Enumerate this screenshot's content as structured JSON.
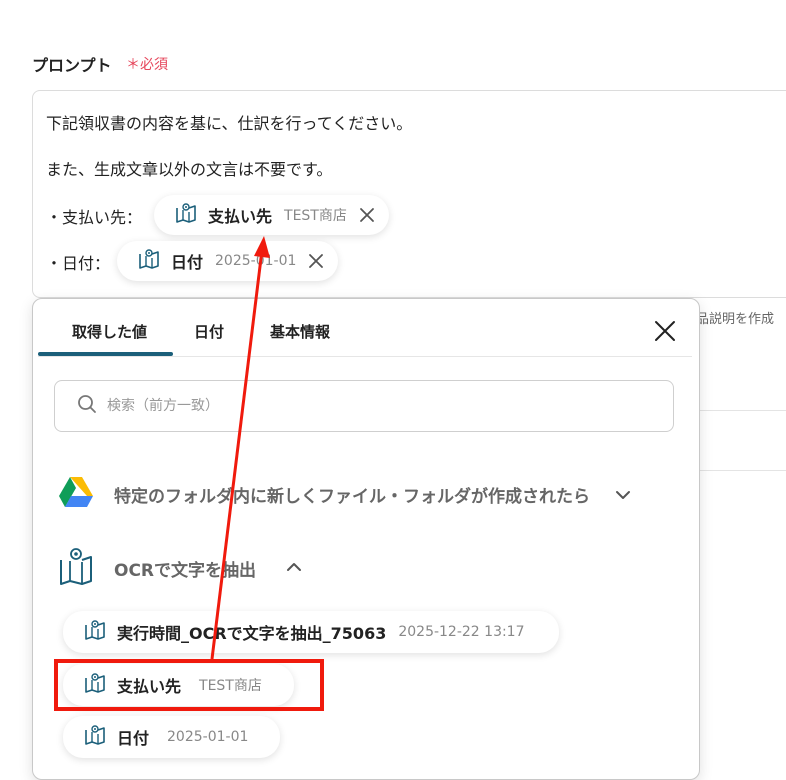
{
  "field": {
    "label": "プロンプト",
    "required_mark": "＊必須"
  },
  "prompt": {
    "line1": "下記領収書の内容を基に、仕訳を行ってください。",
    "line2": "また、生成文章以外の文言は不要です。",
    "line3_prefix": "・支払い先：",
    "line4_prefix": "・日付："
  },
  "inserted_chips": [
    {
      "name": "支払い先",
      "value": "TEST商店"
    },
    {
      "name": "日付",
      "value": "2025-01-01"
    }
  ],
  "background_right": {
    "text": "品説明を作成"
  },
  "panel": {
    "tabs": [
      "取得した値",
      "日付",
      "基本情報"
    ],
    "search_placeholder": "検索（前方一致）",
    "sections": [
      {
        "title": "特定のフォルダ内に新しくファイル・フォルダが作成されたら",
        "icon": "google-drive-icon",
        "expanded": false
      },
      {
        "title": "OCRで文字を抽出",
        "icon": "ocr-book-icon",
        "expanded": true
      }
    ],
    "items": [
      {
        "name": "実行時間_OCRで文字を抽出_75063",
        "value": "2025-12-22 13:17"
      },
      {
        "name": "支払い先",
        "value": "TEST商店"
      },
      {
        "name": "日付",
        "value": "2025-01-01"
      }
    ]
  },
  "colors": {
    "accent": "#1b5f7a",
    "required": "#e6455a",
    "annotation": "#f01a0d"
  }
}
